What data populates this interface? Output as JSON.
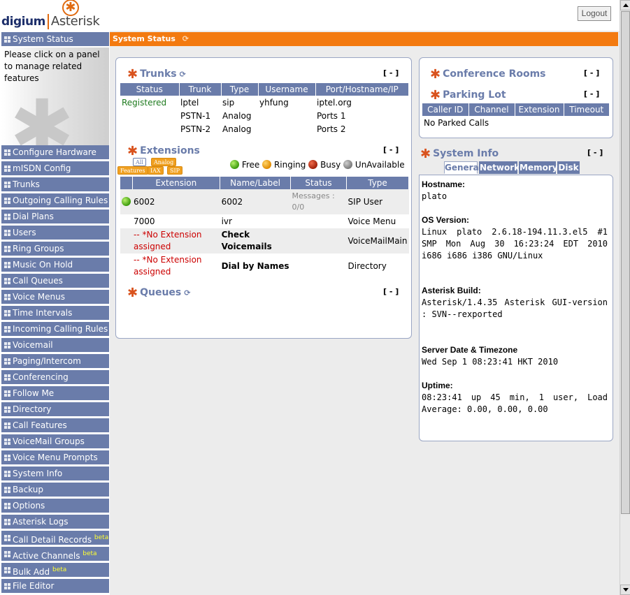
{
  "header": {
    "logo_digium": "digium",
    "logo_asterisk": "Asterisk",
    "logout_label": "Logout"
  },
  "sidebar": {
    "active": "System Status",
    "info": "Please click on a panel to manage related features",
    "items": [
      {
        "label": "Configure Hardware"
      },
      {
        "label": "mISDN Config"
      },
      {
        "label": "Trunks"
      },
      {
        "label": "Outgoing Calling Rules"
      },
      {
        "label": "Dial Plans"
      },
      {
        "label": "Users"
      },
      {
        "label": "Ring Groups"
      },
      {
        "label": "Music On Hold"
      },
      {
        "label": "Call Queues"
      },
      {
        "label": "Voice Menus"
      },
      {
        "label": "Time Intervals"
      },
      {
        "label": "Incoming Calling Rules"
      },
      {
        "label": "Voicemail"
      },
      {
        "label": "Paging/Intercom"
      },
      {
        "label": "Conferencing"
      },
      {
        "label": "Follow Me"
      },
      {
        "label": "Directory"
      },
      {
        "label": "Call Features"
      },
      {
        "label": "VoiceMail Groups"
      },
      {
        "label": "Voice Menu Prompts"
      },
      {
        "label": "System Info"
      },
      {
        "label": "Backup"
      },
      {
        "label": "Options"
      },
      {
        "label": "Asterisk Logs"
      },
      {
        "label": "Call Detail Records",
        "badge": "beta"
      },
      {
        "label": "Active Channels",
        "badge": "beta"
      },
      {
        "label": "Bulk Add",
        "badge": "beta"
      },
      {
        "label": "File Editor"
      }
    ]
  },
  "main": {
    "title": "System Status",
    "trunks": {
      "title": "Trunks",
      "collapse": "[ - ]",
      "columns": [
        "Status",
        "Trunk",
        "Type",
        "Username",
        "Port/Hostname/IP"
      ],
      "rows": [
        {
          "status": "Registered",
          "trunk": "lptel",
          "type": "sip",
          "username": "yhfung",
          "host": "iptel.org"
        },
        {
          "status": "",
          "trunk": "PSTN-1",
          "type": "Analog",
          "username": "",
          "host": "Ports 1"
        },
        {
          "status": "",
          "trunk": "PSTN-2",
          "type": "Analog",
          "username": "",
          "host": "Ports 2"
        }
      ]
    },
    "extensions": {
      "title": "Extensions",
      "collapse": "[ - ]",
      "filters": {
        "all": "All",
        "analog": "Analog",
        "features": "Features",
        "iax": "IAX",
        "sip": "SIP"
      },
      "legend": {
        "free": "Free",
        "ringing": "Ringing",
        "busy": "Busy",
        "unavailable": "UnAvailable"
      },
      "columns": [
        "Extension",
        "Name/Label",
        "Status",
        "Type"
      ],
      "rows": [
        {
          "ext": "6002",
          "name": "6002",
          "status": "Messages : 0/0",
          "type": "SIP User"
        },
        {
          "ext": "7000",
          "name": "ivr",
          "status": "",
          "type": "Voice Menu"
        },
        {
          "ext": "-- *No Extension assigned",
          "name": "Check Voicemails",
          "status": "",
          "type": "VoiceMailMain"
        },
        {
          "ext": "-- *No Extension assigned",
          "name": "Dial by Names",
          "status": "",
          "type": "Directory"
        }
      ]
    },
    "queues": {
      "title": "Queues",
      "collapse": "[ - ]"
    },
    "conference": {
      "title": "Conference Rooms",
      "collapse": "[ - ]"
    },
    "parking": {
      "title": "Parking Lot",
      "collapse": "[ - ]",
      "columns": [
        "Caller ID",
        "Channel",
        "Extension",
        "Timeout"
      ],
      "empty": "No Parked Calls"
    },
    "sysinfo": {
      "title": "System Info",
      "collapse": "[ - ]",
      "tabs": [
        "General",
        "Network",
        "Memory",
        "Disk"
      ],
      "hostname_label": "Hostname:",
      "hostname": "plato",
      "os_label": "OS Version:",
      "os": "Linux plato 2.6.18-194.11.3.el5 #1 SMP Mon Aug 30 16:23:24 EDT 2010 i686 i686 i386 GNU/Linux",
      "build_label": "Asterisk Build:",
      "build": "Asterisk/1.4.35 Asterisk GUI-version : SVN--rexported",
      "date_label": "Server Date & Timezone",
      "date": "Wed Sep 1 08:23:41 HKT 2010",
      "uptime_label": "Uptime:",
      "uptime": "08:23:41 up 45 min, 1 user, Load Average: 0.00, 0.00, 0.00"
    }
  }
}
